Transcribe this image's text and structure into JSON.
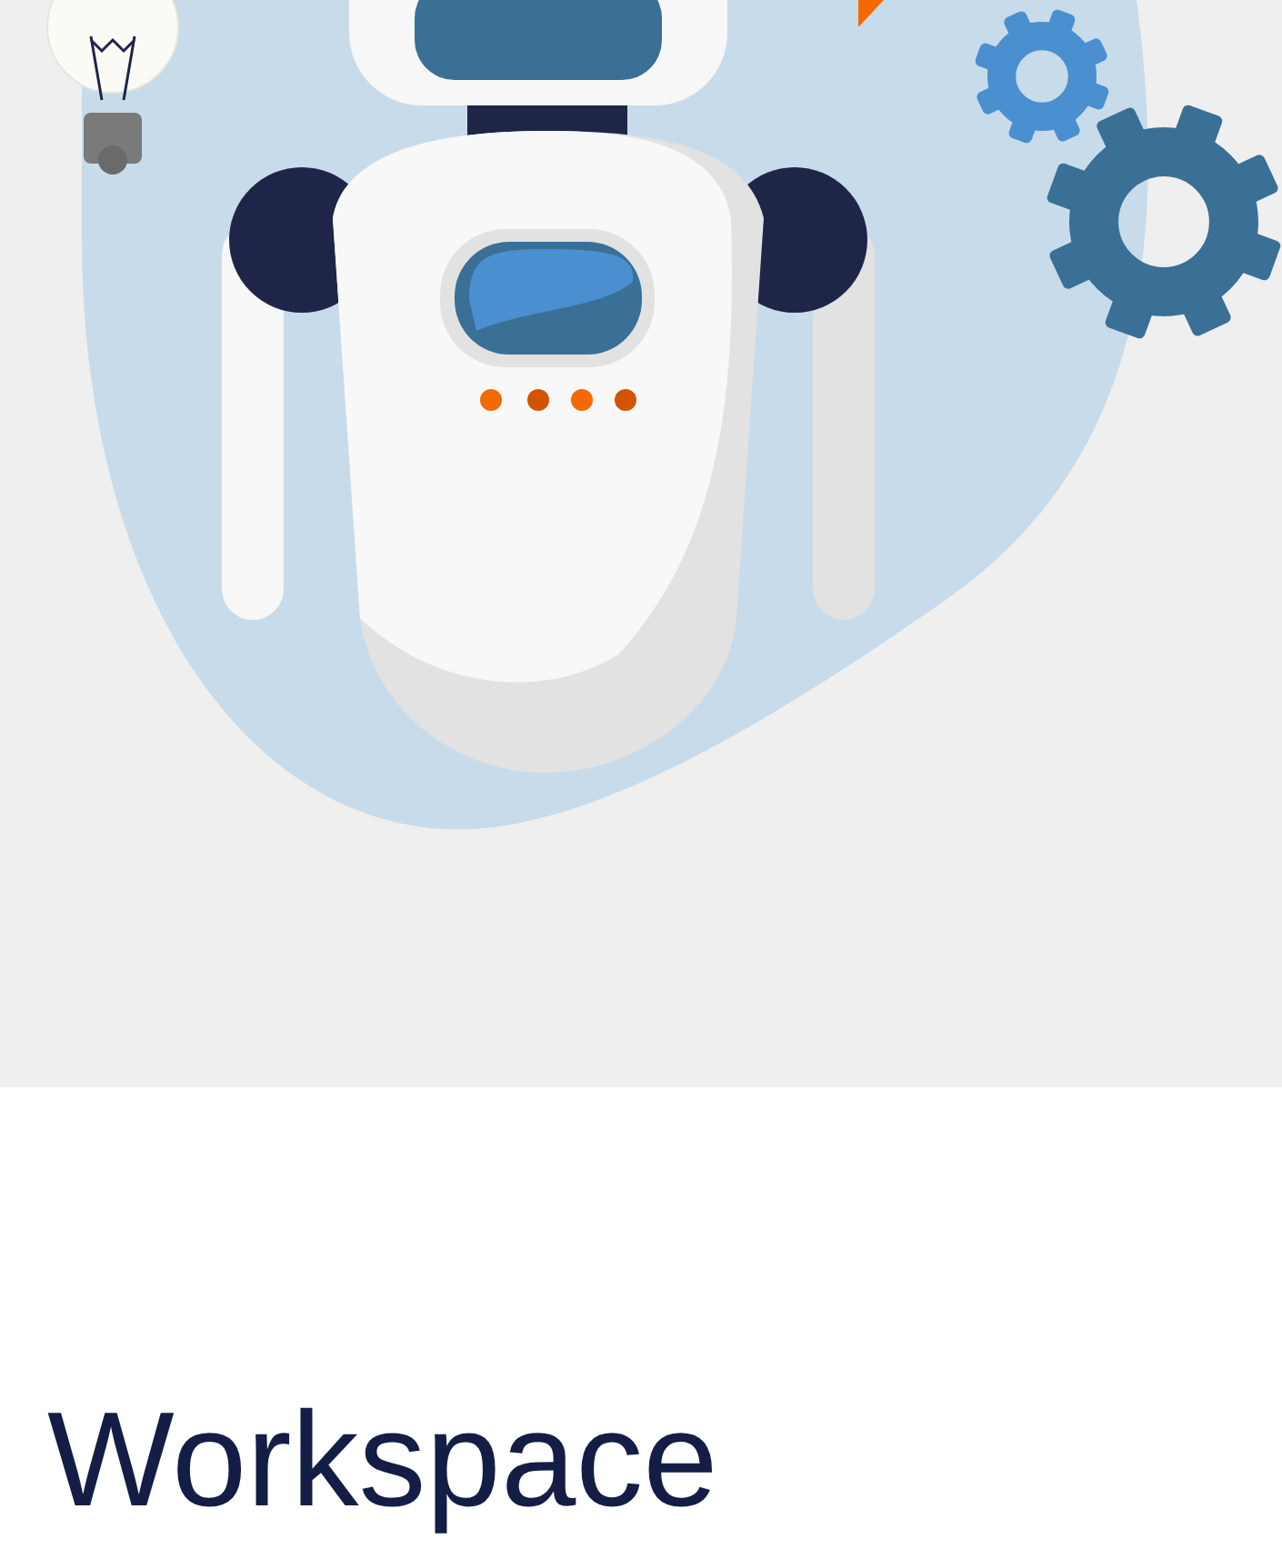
{
  "hero": {
    "heading": "Workspace"
  }
}
